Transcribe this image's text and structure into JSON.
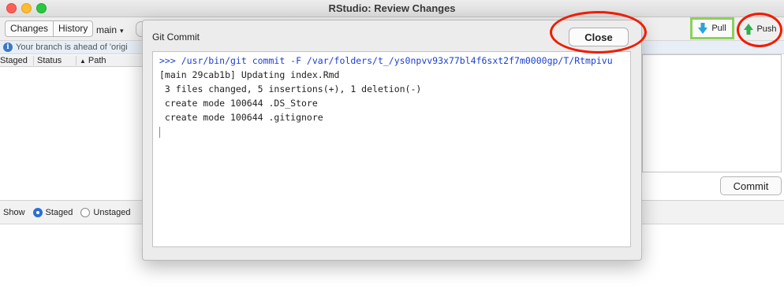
{
  "window": {
    "title": "RStudio: Review Changes"
  },
  "toolbar": {
    "changes_label": "Changes",
    "history_label": "History",
    "branch": "main",
    "pull_label": "Pull",
    "push_label": "Push"
  },
  "info": {
    "text": "Your branch is ahead of 'origi"
  },
  "table": {
    "headers": [
      "Staged",
      "Status",
      "Path"
    ]
  },
  "commit_panel": {
    "commit_label": "Commit"
  },
  "show_bar": {
    "show_label": "Show",
    "options": [
      {
        "label": "Staged",
        "selected": true
      },
      {
        "label": "Unstaged",
        "selected": false
      }
    ]
  },
  "dialog": {
    "title": "Git Commit",
    "close_label": "Close",
    "output": {
      "command": ">>> /usr/bin/git commit -F /var/folders/t_/ys0npvv93x77bl4f6sxt2f7m0000gp/T/Rtmpivu",
      "lines": [
        "[main 29cab1b] Updating index.Rmd",
        " 3 files changed, 5 insertions(+), 1 deletion(-)",
        " create mode 100644 .DS_Store",
        " create mode 100644 .gitignore"
      ]
    }
  },
  "colors": {
    "annotation_red": "#f01c00",
    "pull_highlight_green": "#8cd05b",
    "pull_arrow": "#2aa3d8",
    "push_arrow": "#2fb04a",
    "command_text": "#1a3fd0"
  }
}
